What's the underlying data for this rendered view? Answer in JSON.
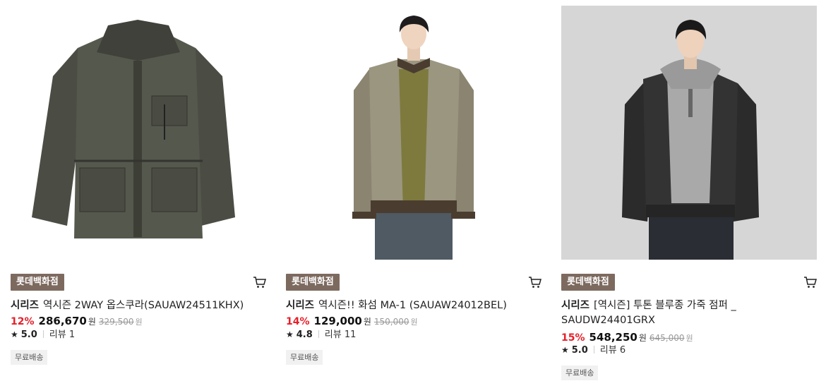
{
  "products": [
    {
      "store_badge": "롯데백화점",
      "brand": "시리즈",
      "name": "역시즌 2WAY 옵스쿠라(SAUAW24511KHX)",
      "discount": "12%",
      "price": "286,670",
      "currency": "원",
      "original_price": "329,500",
      "rating": "5.0",
      "review": "리뷰 1",
      "shipping": "무료배송",
      "image_subject": "olive field jacket"
    },
    {
      "store_badge": "롯데백화점",
      "brand": "시리즈",
      "name": "역시즌!! 화섬 MA-1 (SAUAW24012BEL)",
      "discount": "14%",
      "price": "129,000",
      "currency": "원",
      "original_price": "150,000",
      "rating": "4.8",
      "review": "리뷰 11",
      "shipping": "무료배송",
      "image_subject": "model in beige bomber jacket"
    },
    {
      "store_badge": "롯데백화점",
      "brand": "시리즈",
      "name": "[역시즌] 투톤 블루종 가죽 점퍼 _ SAUDW24401GRX",
      "discount": "15%",
      "price": "548,250",
      "currency": "원",
      "original_price": "645,000",
      "rating": "5.0",
      "review": "리뷰 6",
      "shipping": "무료배송",
      "image_subject": "model in black leather blouson"
    }
  ],
  "icons": {
    "cart": "cart-icon",
    "star": "star-icon"
  },
  "colors": {
    "discount": "#e6202a",
    "badge": "#7d6a5f",
    "image_bg_3": "#d6d6d6"
  }
}
